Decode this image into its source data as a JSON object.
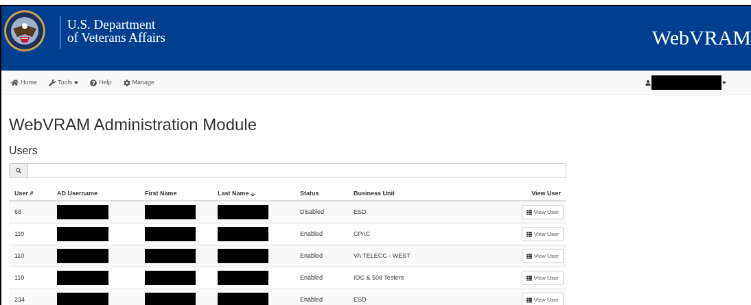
{
  "header": {
    "agency_line_1": "U.S. Department",
    "agency_line_2": "of Veterans Affairs",
    "app_name": "WebVRAM"
  },
  "nav": {
    "items": [
      {
        "kind": "home",
        "label": "Home",
        "dropdown": false
      },
      {
        "kind": "tools",
        "label": "Tools",
        "dropdown": true
      },
      {
        "kind": "help",
        "label": "Help",
        "dropdown": false
      },
      {
        "kind": "manage",
        "label": "Manage",
        "dropdown": false
      }
    ]
  },
  "page_title": "WebVRAM Administration Module",
  "section_title": "Users",
  "table": {
    "columns": [
      {
        "label": "User #",
        "sorted": false
      },
      {
        "label": "AD Username",
        "sorted": false
      },
      {
        "label": "First Name",
        "sorted": false
      },
      {
        "label": "Last Name",
        "sorted": true
      },
      {
        "label": "Status",
        "sorted": false
      },
      {
        "label": "Business Unit",
        "sorted": false
      },
      {
        "label": "View User",
        "sorted": false
      }
    ],
    "rows": [
      {
        "user_no": "68",
        "status": "Disabled",
        "business_unit": "ESD",
        "action": "View User"
      },
      {
        "user_no": "110",
        "status": "Enabled",
        "business_unit": "CPAC",
        "action": "View User"
      },
      {
        "user_no": "110",
        "status": "Enabled",
        "business_unit": "VA TELECC - WEST",
        "action": "View User"
      },
      {
        "user_no": "110",
        "status": "Enabled",
        "business_unit": "IOC & 508 Testers",
        "action": "View User"
      },
      {
        "user_no": "234",
        "status": "Enabled",
        "business_unit": "ESD",
        "action": "View User"
      }
    ]
  }
}
